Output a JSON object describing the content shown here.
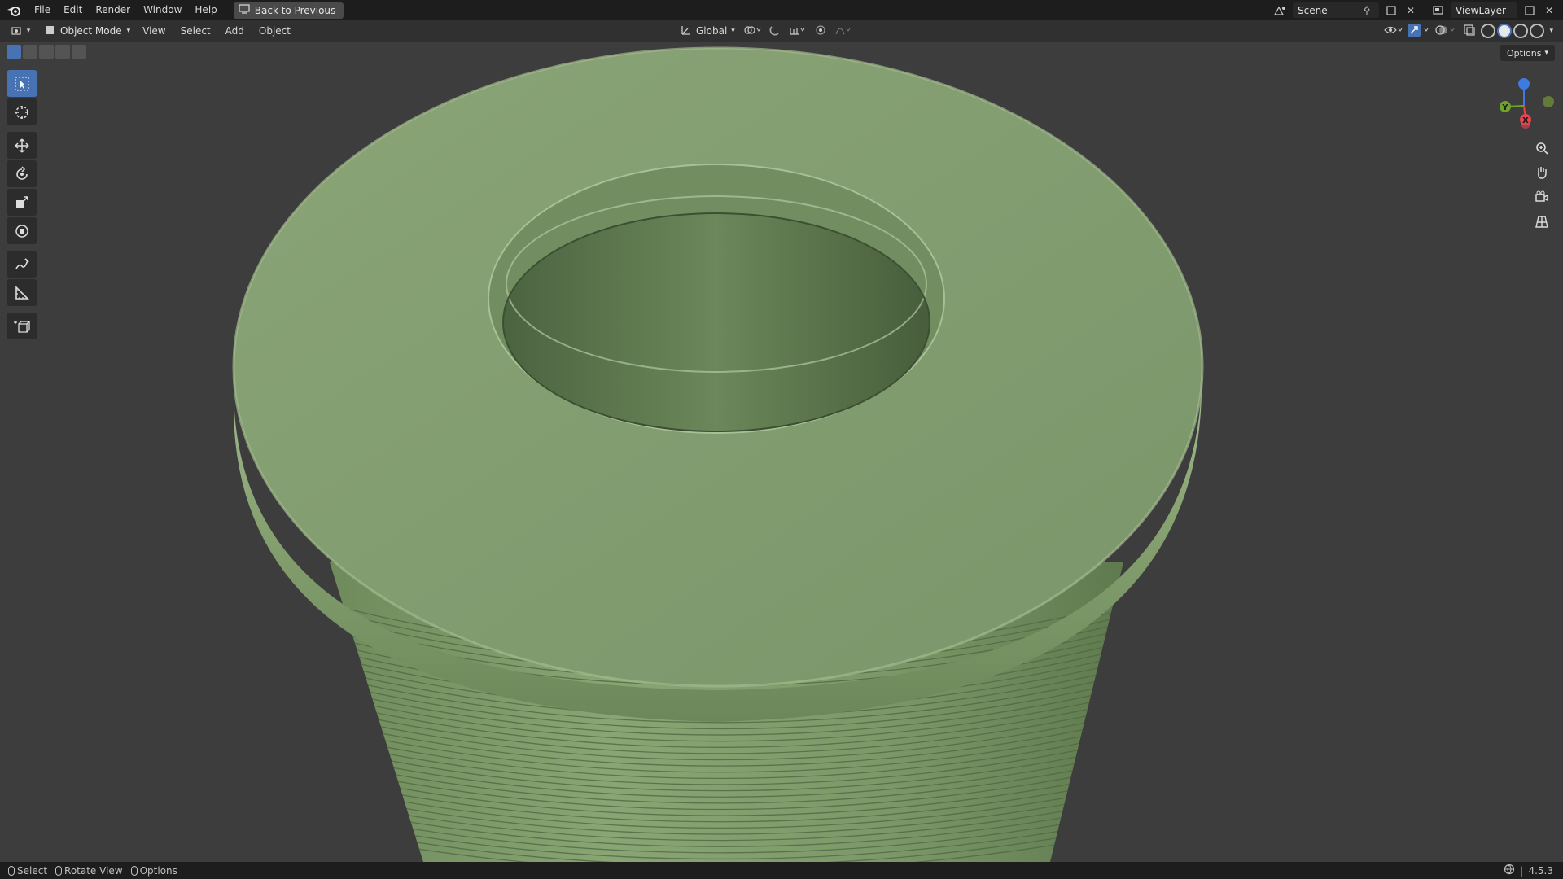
{
  "topbar": {
    "menu": [
      "File",
      "Edit",
      "Render",
      "Window",
      "Help"
    ],
    "back_button": "Back to Previous",
    "scene": "Scene",
    "view_layer": "ViewLayer"
  },
  "header": {
    "mode": "Object Mode",
    "menus": [
      "View",
      "Select",
      "Add",
      "Object"
    ],
    "orientation": "Global",
    "options": "Options"
  },
  "statusbar": {
    "select": "Select",
    "rotate": "Rotate View",
    "options": "Options",
    "version": "4.5.3"
  },
  "gizmo": {
    "x_label": "X",
    "y_label": "Y",
    "x_color": "#e8434f",
    "y_color": "#6ea42a",
    "z_color": "#3d7be0"
  },
  "colors": {
    "accent": "#4772b3",
    "mesh": "#7e9a6a"
  }
}
